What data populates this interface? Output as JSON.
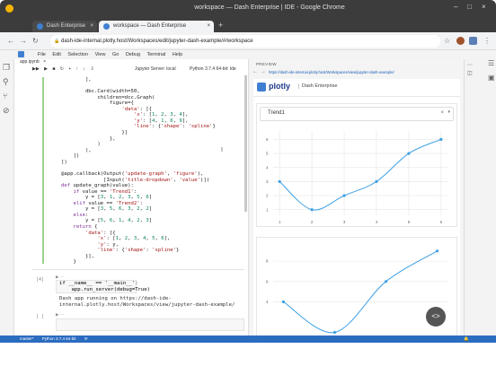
{
  "window": {
    "title": "workspace — Dash Enterprise | IDE - Google Chrome",
    "colors": {
      "titlebar": "#3c3c3c",
      "accent": "#2b6cc0"
    }
  },
  "tabs": [
    {
      "label": "Dash Enterprise",
      "close": "×"
    },
    {
      "label": "workspace — Dash Enterprise",
      "close": "×"
    }
  ],
  "new_tab": "+",
  "address": {
    "url": "dash-ide-internal.plotly.host/Workspaces/edit/jupyter-dash-example/#/workspace"
  },
  "menu": [
    "File",
    "Edit",
    "Selection",
    "View",
    "Go",
    "Debug",
    "Terminal",
    "Help"
  ],
  "notebook": {
    "tab_label": "app.ipynb",
    "kernel": "Jupyter Server: local",
    "python": "Python 3.7.4 64-bit: Ide",
    "code_lines": [
      "        ],",
      "",
      "        dbc.Card(width=50,",
      "            children=dcc.Graph(",
      "                figure={",
      "                    'data': [{",
      "                        'x': [1, 2, 3, 4],",
      "                        'y': [4, 1, 6, 9],",
      "                        'line': {'shape': 'spline'}",
      "                    }]",
      "                },",
      "            )",
      "        ),",
      "    ])",
      "])",
      "",
      "@app.callback(Output('update-graph', 'figure'),",
      "              [Input('title-dropdown', 'value')])",
      "def update_graph(value):",
      "    if value == 'Trend1':",
      "        y = [3, 1, 2, 3, 5, 6]",
      "    elif value == 'Trend2':",
      "        y = [3, 5, 6, 3, 2, 2]",
      "    else:",
      "        y = [5, 6, 1, 4, 2, 3]",
      "    return {",
      "        'data': [{",
      "            'x': [1, 2, 3, 4, 5, 6],",
      "            'y': y,",
      "            'line': {'shape': 'spline'}",
      "        }],",
      "    }"
    ],
    "cell4_label": "[4]",
    "cell4_code": [
      "if __name__ == '__main__':",
      "    app.run_server(debug=True)"
    ],
    "cell4_output": [
      "Dash app running on https://dash-ide-",
      "internal.plotly.host/Workspaces/view/jupyter-dash-example/"
    ],
    "cell5_label": "[ ]"
  },
  "preview": {
    "label": "PREVIEW",
    "url": "https://dash-ide-internal.plotly.host/Workspaces/view/jupyter-dash-example/",
    "brand": "plotly",
    "brand_sub": "Dash Enterprise",
    "dropdown_value": "Trend1",
    "dropdown_clear": "×"
  },
  "statusbar": {
    "branch": "master*",
    "python": "Python 3.7.4 64-bit"
  },
  "chart_data": [
    {
      "type": "line",
      "title": "",
      "x": [
        1,
        2,
        3,
        4,
        5,
        6
      ],
      "y": [
        3,
        1,
        2,
        3,
        5,
        6
      ],
      "xlim": [
        0.8,
        6.2
      ],
      "ylim": [
        0.6,
        6.6
      ],
      "xticks": [
        "1",
        "2",
        "3",
        "4",
        "5",
        "6"
      ],
      "yticks": [
        "1",
        "2",
        "3",
        "4",
        "5",
        "6"
      ],
      "grid": true,
      "line_shape": "spline",
      "color": "#3ea0e4"
    },
    {
      "type": "line",
      "title": "",
      "x": [
        1,
        2,
        3,
        4
      ],
      "y": [
        4,
        1,
        6,
        9
      ],
      "xlim": [
        0.8,
        4.2
      ],
      "ylim": [
        0.6,
        9.6
      ],
      "yticks": [
        "4",
        "6",
        "8"
      ],
      "grid": true,
      "line_shape": "spline",
      "color": "#3ea0e4"
    }
  ]
}
